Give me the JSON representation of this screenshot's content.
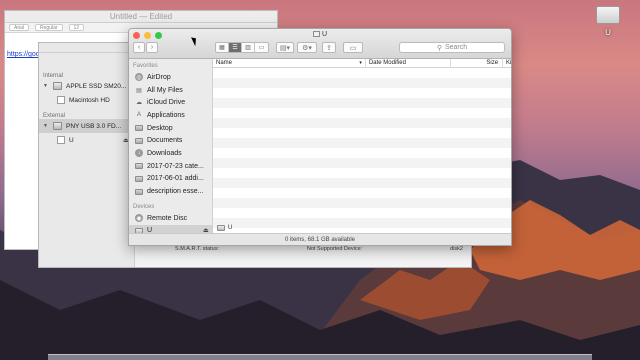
{
  "desktop": {
    "icon_label": "U"
  },
  "textedit": {
    "title": "Untitled — Edited",
    "font_style": "Regular",
    "font_name": "Arial",
    "font_size": "12",
    "link_text": "https://goo"
  },
  "disk_utility": {
    "internal_label": "Internal",
    "external_label": "External",
    "devices": [
      {
        "name": "APPLE SSD SM20...",
        "level": "disk",
        "selected": false
      },
      {
        "name": "Macintosh HD",
        "level": "volume",
        "selected": false
      },
      {
        "name": "PNY USB 3.0 FD...",
        "level": "disk",
        "selected": true
      },
      {
        "name": "U",
        "level": "volume",
        "selected": false
      }
    ],
    "smart_label": "S.M.A.R.T. status:",
    "smart_value": "Not Supported",
    "device_label": "Device:",
    "device_value": "disk2"
  },
  "finder": {
    "title": "U",
    "search_placeholder": "Search",
    "favorites_label": "Favorites",
    "devices_label": "Devices",
    "favorites": [
      {
        "label": "AirDrop",
        "icon": "airdrop-icon"
      },
      {
        "label": "All My Files",
        "icon": "all-files-icon"
      },
      {
        "label": "iCloud Drive",
        "icon": "icloud-icon"
      },
      {
        "label": "Applications",
        "icon": "applications-icon"
      },
      {
        "label": "Desktop",
        "icon": "folder-icon"
      },
      {
        "label": "Documents",
        "icon": "folder-icon"
      },
      {
        "label": "Downloads",
        "icon": "downloads-icon"
      },
      {
        "label": "2017-07-23 cate...",
        "icon": "folder-icon"
      },
      {
        "label": "2017-06-01 addi...",
        "icon": "folder-icon"
      },
      {
        "label": "description esse...",
        "icon": "folder-icon"
      }
    ],
    "devices": [
      {
        "label": "Remote Disc",
        "icon": "remote-disc-icon",
        "selected": false
      },
      {
        "label": "U",
        "icon": "usb-drive-icon",
        "selected": true
      }
    ],
    "columns": {
      "name": "Name",
      "date": "Date Modified",
      "size": "Size",
      "kind": "Ki"
    },
    "path": "U",
    "status": "0 items, 68.1 GB available"
  },
  "colors": {
    "close": "#fc605b",
    "minimize": "#fdbc40",
    "zoom": "#34c84a"
  }
}
